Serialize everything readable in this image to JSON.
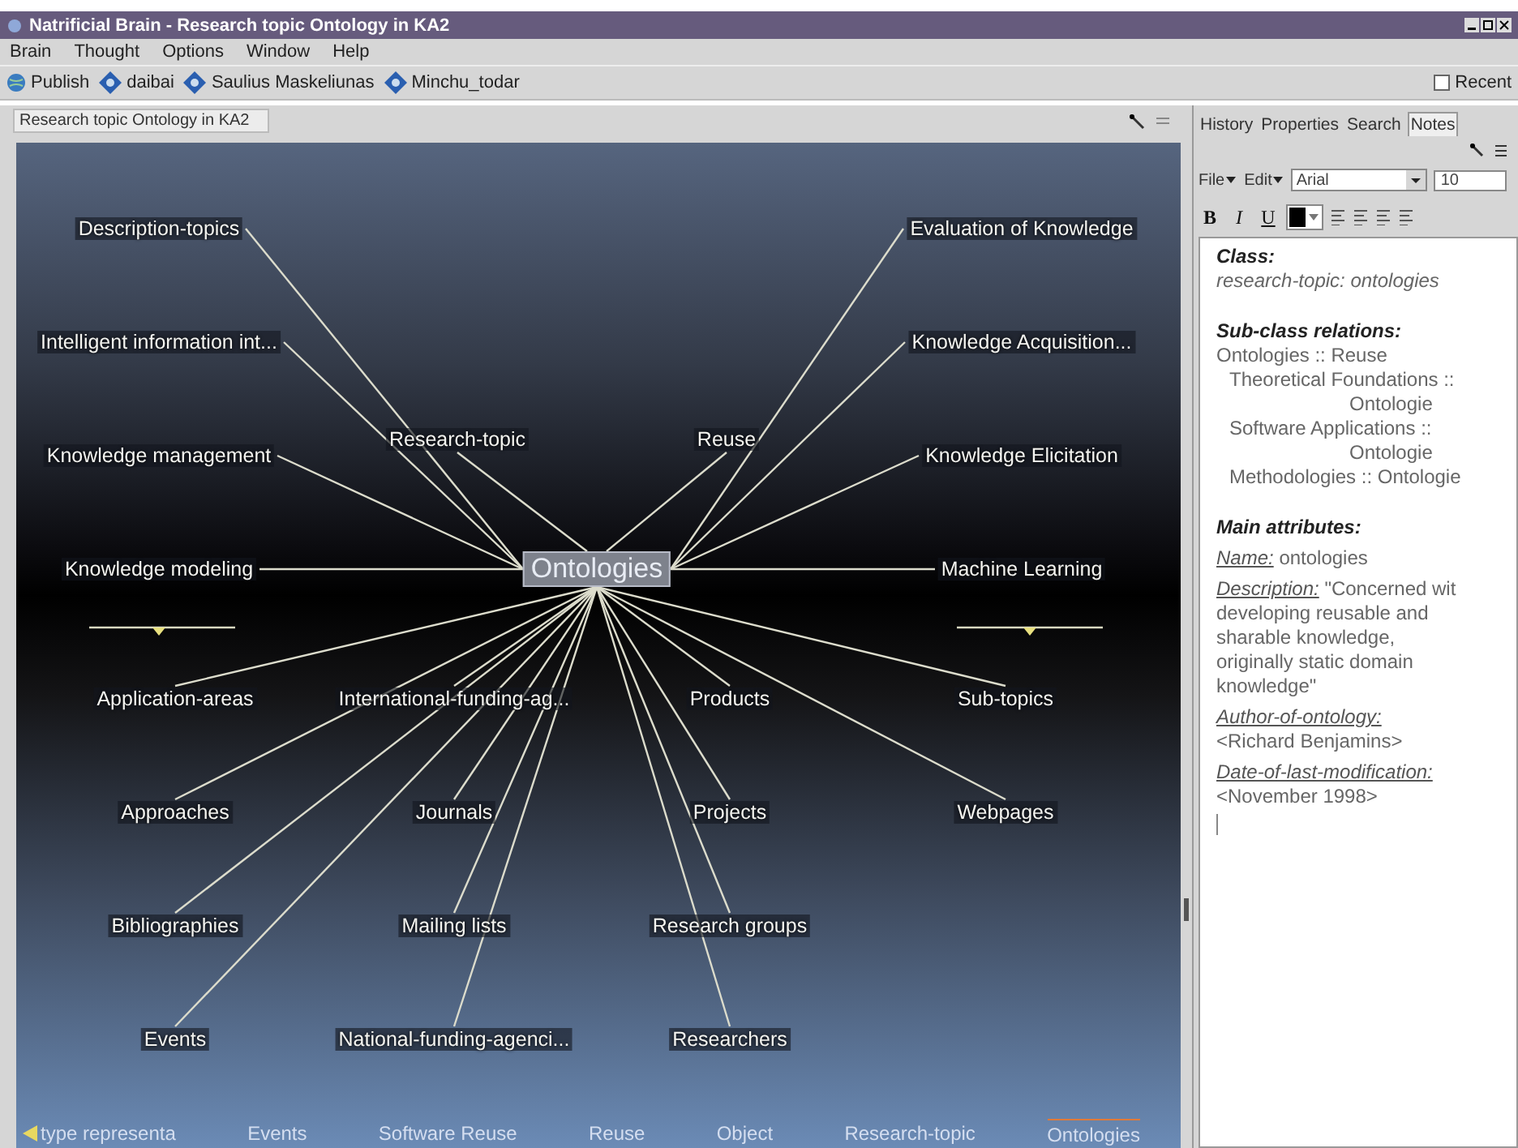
{
  "window": {
    "title": "Natrificial Brain - Research topic Ontology in KA2"
  },
  "menu": [
    "Brain",
    "Thought",
    "Options",
    "Window",
    "Help"
  ],
  "toolbar": {
    "items": [
      {
        "kind": "publish",
        "label": "Publish"
      },
      {
        "kind": "thought",
        "label": "daibai"
      },
      {
        "kind": "thought",
        "label": "Saulius Maskeliunas"
      },
      {
        "kind": "thought",
        "label": "Minchu_todar"
      }
    ],
    "recent": {
      "label": "Recent",
      "checked": false
    }
  },
  "graph": {
    "title": "Research topic Ontology in KA2",
    "central": "Ontologies",
    "parents": [
      "Description-topics",
      "Intelligent information int...",
      "Knowledge management",
      "Knowledge modeling",
      "Evaluation of Knowledge",
      "Knowledge Acquisition...",
      "Knowledge Elicitation",
      "Machine Learning"
    ],
    "jumps": [
      "Research-topic",
      "Reuse"
    ],
    "children": [
      "Application-areas",
      "International-funding-ag...",
      "Products",
      "Sub-topics",
      "Approaches",
      "Journals",
      "Projects",
      "Webpages",
      "Bibliographies",
      "Mailing lists",
      "Research groups",
      "Events",
      "National-funding-agenci...",
      "Researchers"
    ],
    "breadcrumb": [
      {
        "label": "type representa",
        "selected": false
      },
      {
        "label": "Events",
        "selected": false
      },
      {
        "label": "Software Reuse",
        "selected": false
      },
      {
        "label": "Reuse",
        "selected": false
      },
      {
        "label": "Object",
        "selected": false
      },
      {
        "label": "Research-topic",
        "selected": false
      },
      {
        "label": "Ontologies",
        "selected": true
      }
    ]
  },
  "notes": {
    "tabs": [
      {
        "label": "History",
        "selected": false
      },
      {
        "label": "Properties",
        "selected": false
      },
      {
        "label": "Search",
        "selected": false
      },
      {
        "label": "Notes",
        "selected": true
      }
    ],
    "format": {
      "menus": [
        "File",
        "Edit"
      ],
      "font": "Arial",
      "size": "10",
      "styles": [
        {
          "kind": "bold",
          "label": "B"
        },
        {
          "kind": "italic",
          "label": "I"
        },
        {
          "kind": "underline",
          "label": "U"
        }
      ]
    },
    "content": [
      {
        "kind": "heading",
        "text": "Class:"
      },
      {
        "kind": "italic",
        "text": "research-topic: ontologies"
      },
      {
        "kind": "heading",
        "text": "Sub-class relations:"
      },
      {
        "kind": "text",
        "text": "Ontologies :: Reuse"
      },
      {
        "kind": "indent",
        "text": "Theoretical Foundations ::"
      },
      {
        "kind": "right",
        "text": "Ontologie"
      },
      {
        "kind": "indent",
        "text": "Software Applications ::"
      },
      {
        "kind": "right",
        "text": "Ontologie"
      },
      {
        "kind": "indent",
        "text": "Methodologies :: Ontologie"
      },
      {
        "kind": "heading",
        "text": "Main attributes:"
      },
      {
        "kind": "attribute",
        "label": "Name:",
        "lines": [
          "ontologies"
        ]
      },
      {
        "kind": "attribute",
        "label": "Description:",
        "lines": [
          "\"Concerned wit",
          "developing reusable and",
          "sharable knowledge,",
          "originally static domain",
          "knowledge\""
        ]
      },
      {
        "kind": "attribute-block",
        "label": "Author-of-ontology:",
        "lines": [
          "<Richard Benjamins>"
        ]
      },
      {
        "kind": "attribute-block",
        "label": "Date-of-last-modification:",
        "lines": [
          "<November 1998>"
        ]
      }
    ]
  }
}
